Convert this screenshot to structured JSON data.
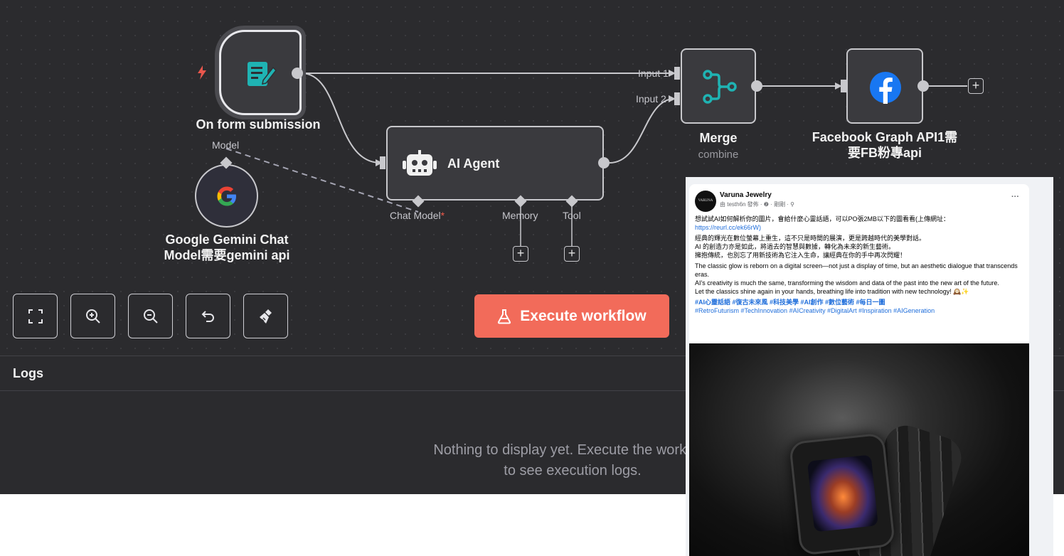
{
  "canvas": {
    "nodes": {
      "trigger": {
        "label": "On form submission"
      },
      "ai_agent": {
        "label": "AI Agent",
        "ports": {
          "chat_model": "Chat Model",
          "required_mark": "*",
          "memory": "Memory",
          "tool": "Tool"
        }
      },
      "gemini": {
        "label": "Google Gemini Chat Model需要gemini api",
        "port": "Model",
        "letter": "G"
      },
      "merge": {
        "label": "Merge",
        "sub": "combine",
        "input1": "Input 1",
        "input2": "Input 2"
      },
      "facebook": {
        "label": "Facebook Graph API1需要FB粉專api"
      }
    },
    "add_symbol": "+"
  },
  "toolbar": {
    "fit_view": "fit-view-icon",
    "zoom_in": "zoom-in-icon",
    "zoom_out": "zoom-out-icon",
    "undo": "undo-icon",
    "clear": "clear-execution-icon"
  },
  "execute_button": {
    "label": "Execute workflow",
    "icon": "flask-icon",
    "color": "#f26b5a"
  },
  "logs": {
    "title": "Logs",
    "empty_text": "Nothing to display yet. Execute the workflow to see execution logs."
  },
  "facebook_post": {
    "page_name": "Varuna Jewelry",
    "meta": "由 testh6n 發佈 · ❷ · 剛剛 · ⚲",
    "avatar_text": "VARUNA",
    "more": "···",
    "line1": "想試試AI如何解析你的圖片，會給什麼心靈話語，可以PO張2MB以下的圖看看(上傳網址：",
    "link": "https://reurl.cc/ek66rW)",
    "zh_1": "經典的輝光在數位螢幕上重生，這不只是時間的展演，更是跨越時代的美學對話。",
    "zh_2": "AI 的創造力亦是如此，將過去的智慧與數據，轉化為未來的新生藝術。",
    "zh_3": "擁抱傳統，也別忘了用新技術為它注入生命，讓經典在你的手中再次閃耀！",
    "en_1": "The classic glow is reborn on a digital screen—not just a display of time, but an aesthetic dialogue that transcends eras.",
    "en_2": "AI's creativity is much the same, transforming the wisdom and data of the past into the new art of the future.",
    "en_3": "Let the classics shine again in your hands, breathing life into tradition with new technology! 🕰️✨",
    "tags_zh": "#AI心靈話語 #復古未來風 #科技美學 #AI創作 #數位藝術 #每日一圖",
    "tags_en": "#RetroFuturism #TechInnovation #AICreativity #DigitalArt #Inspiration #AIGeneration"
  },
  "colors": {
    "canvas_bg": "#2b2b2e",
    "node_bg": "#3a3a3e",
    "node_border": "#c8c8cc",
    "accent_teal": "#1fb3b3",
    "facebook_blue": "#1877f2",
    "trigger_bolt": "#e8564c"
  }
}
